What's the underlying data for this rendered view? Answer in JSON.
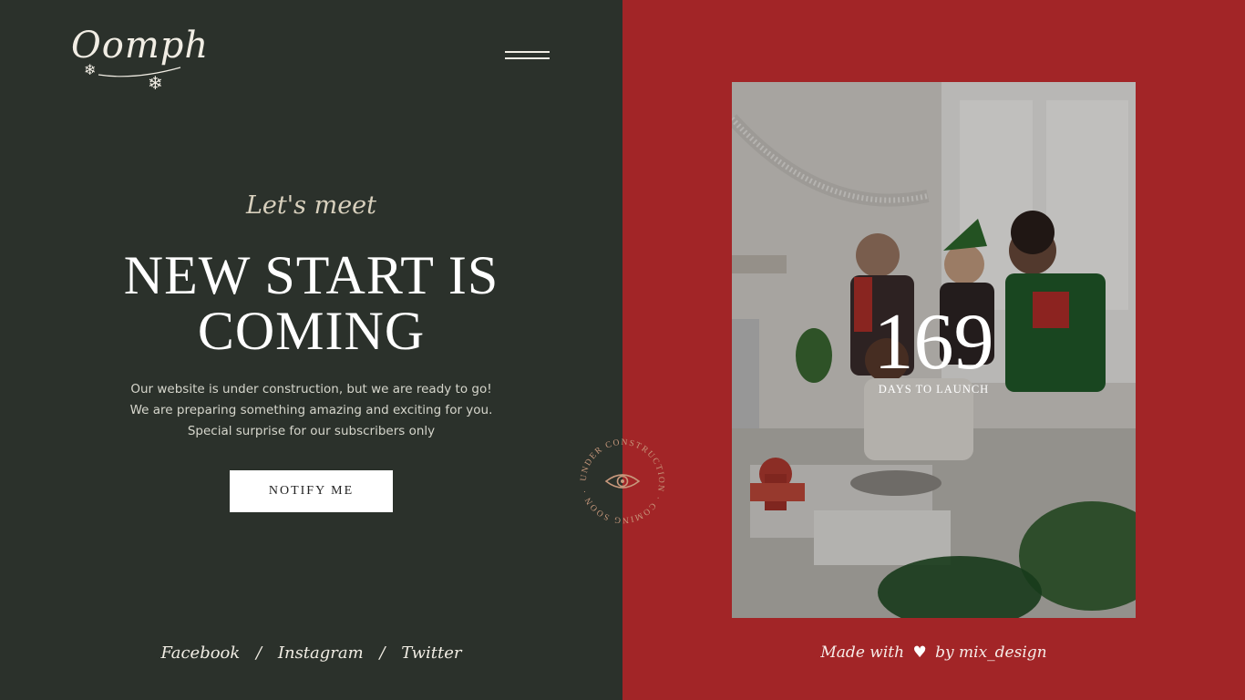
{
  "brand": {
    "logo_text": "Oomph"
  },
  "hero": {
    "eyebrow": "Let's meet",
    "headline_line1": "NEW START IS",
    "headline_line2": "COMING",
    "description": [
      "Our website is under construction, but we are ready to go!",
      "We are preparing something amazing and exciting for you.",
      "Special surprise for our subscribers only"
    ],
    "cta_label": "NOTIFY ME"
  },
  "socials": [
    {
      "label": "Facebook"
    },
    {
      "label": "Instagram"
    },
    {
      "label": "Twitter"
    }
  ],
  "socials_separator": "/",
  "badge": {
    "ring_text": "UNDER CONSTRUCTION · COMING SOON ·"
  },
  "countdown": {
    "value": "169",
    "label": "DAYS TO LAUNCH"
  },
  "footer": {
    "made_with_prefix": "Made with",
    "made_with_suffix": "by mix_design"
  },
  "colors": {
    "left_bg": "#2b312b",
    "right_bg": "#a22527",
    "cream": "#f1ede4",
    "badge": "#c7987c"
  },
  "icons": {
    "menu": "hamburger-icon",
    "heart": "heart-icon",
    "eye": "eye-icon",
    "snowflake": "snowflake-icon"
  }
}
